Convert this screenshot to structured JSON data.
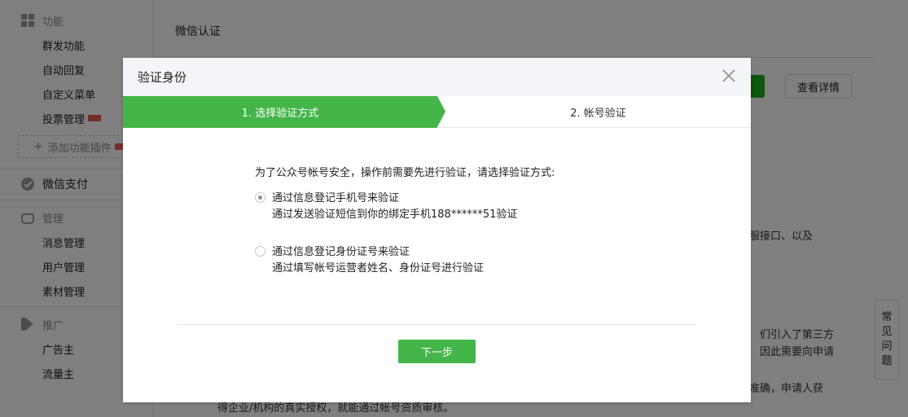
{
  "sidebar": {
    "groups": [
      {
        "head": "功能",
        "items": [
          "群发功能",
          "自动回复",
          "自定义菜单",
          "投票管理"
        ],
        "add_plugin": "添加功能插件"
      },
      {
        "head": "微信支付"
      },
      {
        "head": "管理",
        "items": [
          "消息管理",
          "用户管理",
          "素材管理"
        ]
      },
      {
        "head": "推广",
        "items": [
          "广告主",
          "流量主"
        ]
      }
    ]
  },
  "main": {
    "title": "微信认证",
    "detail_button": "查看详情",
    "bg_text_1": "客服接口、以及",
    "bg_text_2": "们引入了第三方",
    "bg_text_3": "因此需要向申请",
    "bg_text_4": "准确，申请人获",
    "bg_text_5": "得企业/机构的真实授权，就能通过帐号资质审核。",
    "help": [
      "常",
      "见",
      "问",
      "题"
    ]
  },
  "dialog": {
    "title": "验证身份",
    "steps": [
      "1. 选择验证方式",
      "2. 帐号验证"
    ],
    "intro": "为了公众号帐号安全，操作前需要先进行验证，请选择验证方式:",
    "options": [
      {
        "title": "通过信息登记手机号来验证",
        "desc": "通过发送验证短信到你的绑定手机188******51验证",
        "checked": true
      },
      {
        "title": "通过信息登记身份证号来验证",
        "desc": "通过填写帐号运营者姓名、身份证号进行验证",
        "checked": false
      }
    ],
    "next_button": "下一步"
  },
  "colors": {
    "accent_green": "#44b549",
    "overlay": "rgba(0,0,0,0.5)"
  }
}
